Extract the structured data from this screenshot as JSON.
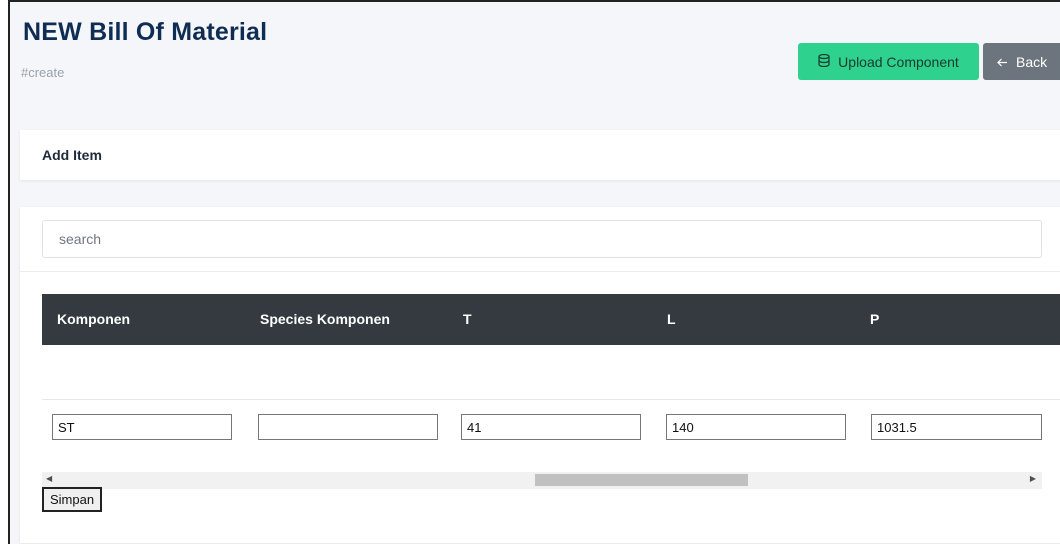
{
  "header": {
    "title": "NEW Bill Of Material",
    "subtitle": "#create",
    "upload_label": "Upload Component",
    "upload_icon": "database-icon",
    "back_label": "Back",
    "back_icon": "arrow-left-icon"
  },
  "add_card": {
    "title": "Add Item"
  },
  "search": {
    "placeholder": "search",
    "value": ""
  },
  "table": {
    "headers": [
      "Komponen",
      "Species Komponen",
      "T",
      "L",
      "P"
    ],
    "row": [
      "ST",
      "",
      "41",
      "140",
      "1031.5"
    ]
  },
  "scrollbar": {
    "left_arrow": "◀",
    "right_arrow": "▶"
  },
  "actions": {
    "save_label": "Simpan"
  },
  "colors": {
    "accent_green": "#2fd18f",
    "back_grey": "#6c757d",
    "table_header": "#343a40",
    "title_navy": "#0f2d52"
  }
}
